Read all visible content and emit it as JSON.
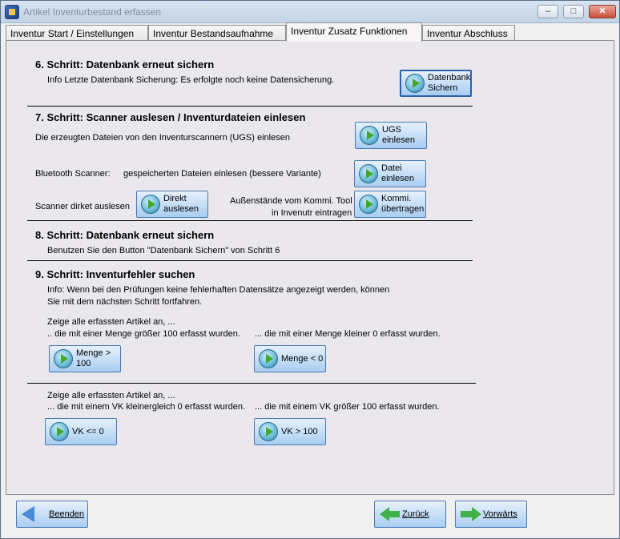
{
  "window": {
    "title": "Artikel Inventurbestand erfassen",
    "controls": {
      "minimize": "–",
      "maximize": "□",
      "close": "✕"
    }
  },
  "tabs": [
    {
      "label": "Inventur Start / Einstellungen"
    },
    {
      "label": "Inventur Bestandsaufnahme"
    },
    {
      "label": "Inventur Zusatz Funktionen"
    },
    {
      "label": "Inventur Abschluss"
    }
  ],
  "step6": {
    "heading": "6. Schritt: Datenbank erneut sichern",
    "info": "Info Letzte Datenbank Sicherung: Es erfolgte noch keine Datensicherung.",
    "button": "Datenbank\nSichern"
  },
  "step7": {
    "heading": "7. Schritt: Scanner auslesen / Inventurdateien einlesen",
    "ugs_text": "Die erzeugten Dateien von den Inventurscannern (UGS) einlesen",
    "ugs_button": "UGS\neinlesen",
    "bt_label": "Bluetooth Scanner:",
    "bt_text": "gespeicherten Dateien einlesen (bessere Variante)",
    "bt_button": "Datei\neinlesen",
    "direct_text": "Scanner dirket auslesen",
    "direct_button": "Direkt\nauslesen",
    "kommi_text_1": "Außenstände vom Kommi. Tool",
    "kommi_text_2": "in Invenutr eintragen",
    "kommi_button": "Kommi.\nübertragen"
  },
  "step8": {
    "heading": "8. Schritt: Datenbank erneut sichern",
    "text": "Benutzen Sie den Button \"Datenbank Sichern\" von Schritt 6"
  },
  "step9": {
    "heading": "9. Schritt: Inventurfehler suchen",
    "info_1": "Info: Wenn bei den Prüfungen keine fehlerhaften Datensätze angezeigt werden, können",
    "info_2": "Sie mit dem nächsten Schritt fortfahren.",
    "group1_title": "Zeige alle erfassten Artikel an, ...",
    "group1_left": ".. die mit einer Menge größer 100 erfasst wurden.",
    "group1_right": "... die mit einer Menge kleiner 0 erfasst wurden.",
    "btn_menge_gt": "Menge >\n100",
    "btn_menge_lt": "Menge < 0",
    "group2_title": "Zeige alle erfassten Artikel an, ...",
    "group2_left": "... die mit einem VK kleinergleich 0 erfasst wurden.",
    "group2_right": "... die mit einem VK größer 100 erfasst wurden.",
    "btn_vk_le": "VK <= 0",
    "btn_vk_gt": "VK > 100"
  },
  "footer": {
    "back_label": "Beenden",
    "prev_label": "Zurück",
    "next_label": "Vorwärts"
  }
}
